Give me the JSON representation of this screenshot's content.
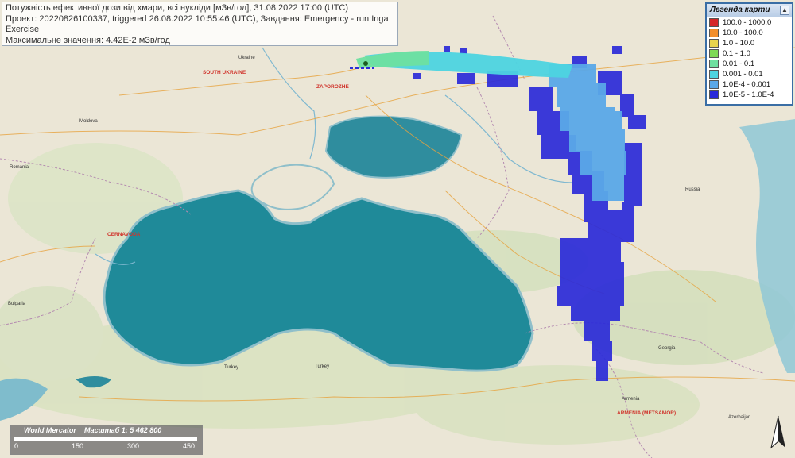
{
  "info": {
    "line1": "Потужність ефективної дози від хмари, всі нукліди [мЗв/год], 31.08.2022 17:00 (UTC)",
    "line2": "Проект: 20220826100337, triggered 26.08.2022 10:55:46 (UTC), Завдання: Emergency - run:Inga",
    "line3": "Exercise",
    "line4": "Максимальне значення: 4.42E-2 мЗв/год"
  },
  "legend": {
    "title": "Легенда карти",
    "collapse": "▲",
    "items": [
      {
        "label": "100.0 - 1000.0",
        "color": "#d62728"
      },
      {
        "label": "10.0 - 100.0",
        "color": "#f28e2b"
      },
      {
        "label": "1.0 - 10.0",
        "color": "#e8d44d"
      },
      {
        "label": "0.1 - 1.0",
        "color": "#7ed957"
      },
      {
        "label": "0.01 - 0.1",
        "color": "#6ee0a0"
      },
      {
        "label": "0.001 - 0.01",
        "color": "#4dd4e0"
      },
      {
        "label": "1.0E-4 - 0.001",
        "color": "#5aa8e8"
      },
      {
        "label": "1.0E-5 - 1.0E-4",
        "color": "#2b2bd9"
      }
    ]
  },
  "scalebar": {
    "projection": "World Mercator",
    "scale": "Масштаб 1: 5 462 800",
    "ticks": [
      "0",
      "150",
      "300",
      "450"
    ]
  },
  "map_labels": {
    "south_ukraine": "SOUTH UKRAINE",
    "zaporozhe": "ZAPOROZHE",
    "cernavoda": "CERNAVODA",
    "armenia_metsamor": "ARMENIA (METSAMOR)",
    "russia": "Russia",
    "turkey1": "Turkey",
    "turkey2": "Turkey",
    "armenia": "Armenia",
    "georgia": "Georgia",
    "azerbaijan": "Azerbaijan",
    "romania": "Romania",
    "bulgaria": "Bulgaria",
    "ukraine": "Ukraine",
    "moldova": "Moldova"
  },
  "colors": {
    "sea": "#1f8a99",
    "land": "#ece6d3",
    "accent": "#3a6ea5"
  }
}
